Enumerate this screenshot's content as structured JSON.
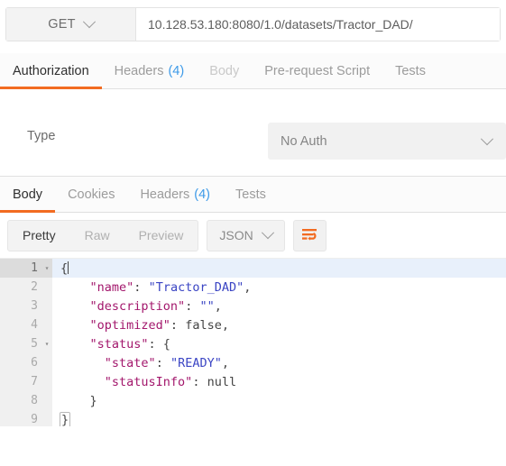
{
  "request": {
    "method": "GET",
    "url": "10.128.53.180:8080/1.0/datasets/Tractor_DAD/",
    "tabs": [
      {
        "label": "Authorization",
        "count": "",
        "state": "active"
      },
      {
        "label": "Headers",
        "count": "(4)",
        "state": "normal"
      },
      {
        "label": "Body",
        "count": "",
        "state": "dim"
      },
      {
        "label": "Pre-request Script",
        "count": "",
        "state": "normal"
      },
      {
        "label": "Tests",
        "count": "",
        "state": "normal"
      }
    ],
    "auth": {
      "type_label": "Type",
      "selected": "No Auth"
    }
  },
  "response": {
    "tabs": [
      {
        "label": "Body",
        "count": "",
        "state": "active"
      },
      {
        "label": "Cookies",
        "count": "",
        "state": "normal"
      },
      {
        "label": "Headers",
        "count": "(4)",
        "state": "normal"
      },
      {
        "label": "Tests",
        "count": "",
        "state": "normal"
      }
    ],
    "view_modes": [
      {
        "label": "Pretty",
        "state": "active"
      },
      {
        "label": "Raw",
        "state": "normal"
      },
      {
        "label": "Preview",
        "state": "normal"
      }
    ],
    "format": "JSON",
    "body_lines": [
      {
        "num": "1",
        "fold": "▾",
        "active": true,
        "indent": "",
        "segments": [
          {
            "t": "{",
            "c": "p"
          }
        ],
        "caret": true
      },
      {
        "num": "2",
        "fold": "",
        "active": false,
        "indent": "    ",
        "segments": [
          {
            "t": "\"name\"",
            "c": "k"
          },
          {
            "t": ": ",
            "c": "p"
          },
          {
            "t": "\"Tractor_DAD\"",
            "c": "s"
          },
          {
            "t": ",",
            "c": "p"
          }
        ]
      },
      {
        "num": "3",
        "fold": "",
        "active": false,
        "indent": "    ",
        "segments": [
          {
            "t": "\"description\"",
            "c": "k"
          },
          {
            "t": ": ",
            "c": "p"
          },
          {
            "t": "\"\"",
            "c": "s"
          },
          {
            "t": ",",
            "c": "p"
          }
        ]
      },
      {
        "num": "4",
        "fold": "",
        "active": false,
        "indent": "    ",
        "segments": [
          {
            "t": "\"optimized\"",
            "c": "k"
          },
          {
            "t": ": ",
            "c": "p"
          },
          {
            "t": "false",
            "c": "p"
          },
          {
            "t": ",",
            "c": "p"
          }
        ]
      },
      {
        "num": "5",
        "fold": "▾",
        "active": false,
        "indent": "    ",
        "segments": [
          {
            "t": "\"status\"",
            "c": "k"
          },
          {
            "t": ": {",
            "c": "p"
          }
        ]
      },
      {
        "num": "6",
        "fold": "",
        "active": false,
        "indent": "      ",
        "segments": [
          {
            "t": "\"state\"",
            "c": "k"
          },
          {
            "t": ": ",
            "c": "p"
          },
          {
            "t": "\"READY\"",
            "c": "s"
          },
          {
            "t": ",",
            "c": "p"
          }
        ]
      },
      {
        "num": "7",
        "fold": "",
        "active": false,
        "indent": "      ",
        "segments": [
          {
            "t": "\"statusInfo\"",
            "c": "k"
          },
          {
            "t": ": ",
            "c": "p"
          },
          {
            "t": "null",
            "c": "p"
          }
        ]
      },
      {
        "num": "8",
        "fold": "",
        "active": false,
        "indent": "    ",
        "segments": [
          {
            "t": "}",
            "c": "p"
          }
        ]
      },
      {
        "num": "9",
        "fold": "",
        "active": false,
        "indent": "",
        "segments": [
          {
            "t": "}",
            "c": "p",
            "match": true
          }
        ]
      }
    ]
  },
  "colors": {
    "accent": "#f26b21",
    "count_blue": "#3d9ae8",
    "json_key": "#a3176c",
    "json_string": "#3b45c4",
    "active_line": "#e8f0fb"
  }
}
